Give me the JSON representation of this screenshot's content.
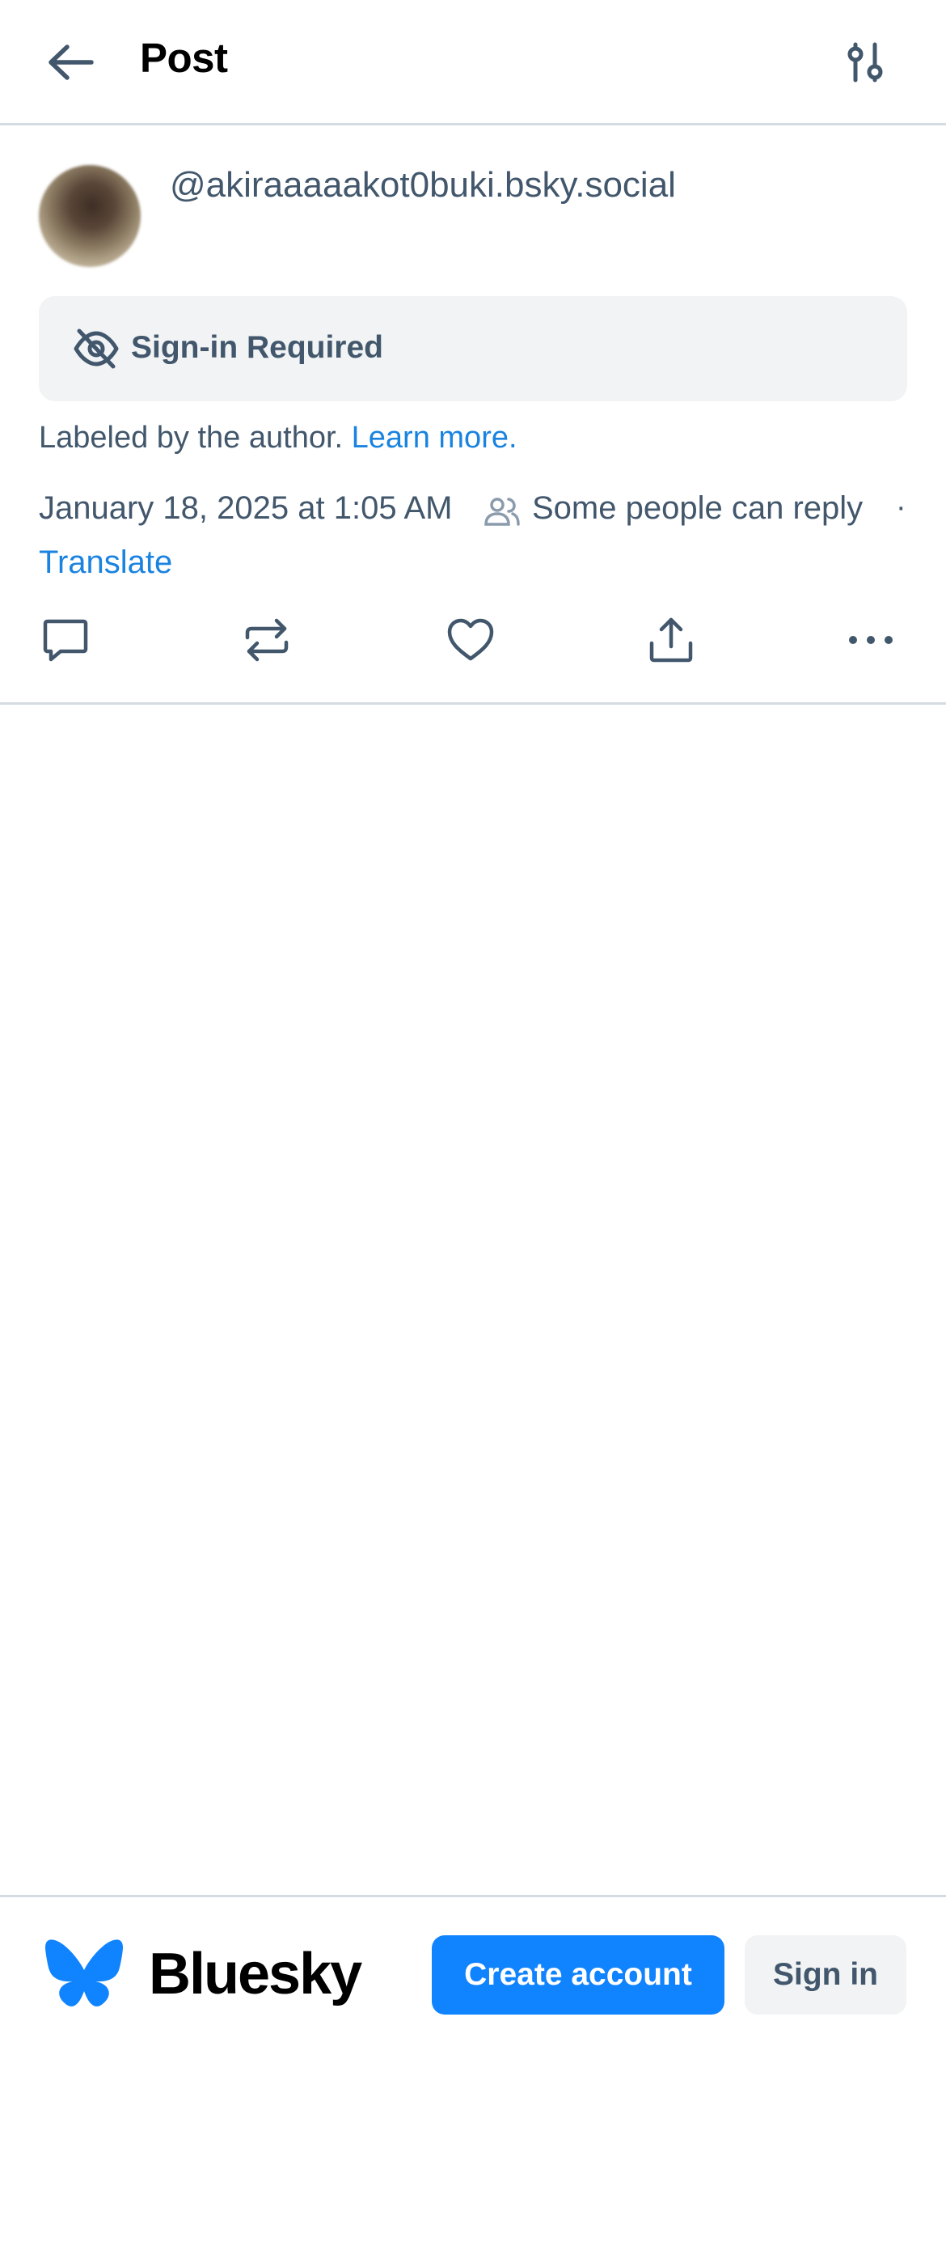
{
  "header": {
    "title": "Post",
    "back_icon": "arrow-left-icon",
    "filter_icon": "sliders-icon"
  },
  "post": {
    "handle": "@akiraaaaakot0buki.bsky.social",
    "warning": {
      "label": "Sign-in Required",
      "icon": "eye-slash-icon"
    },
    "label_notice": "Labeled by the author.",
    "learn_more": "Learn more.",
    "timestamp": "January 18, 2025 at 1:05 AM",
    "reply_setting": "Some people can reply",
    "separator": "·",
    "translate": "Translate",
    "actions": [
      "reply-icon",
      "repost-icon",
      "like-icon",
      "share-icon",
      "more-icon"
    ]
  },
  "footer": {
    "brand": "Bluesky",
    "create_account": "Create account",
    "sign_in": "Sign in"
  },
  "colors": {
    "text": "#42576c",
    "link": "#1a83e0",
    "primary": "#1083fe",
    "border": "#d4dbe2",
    "muted_bg": "#f1f3f5"
  }
}
